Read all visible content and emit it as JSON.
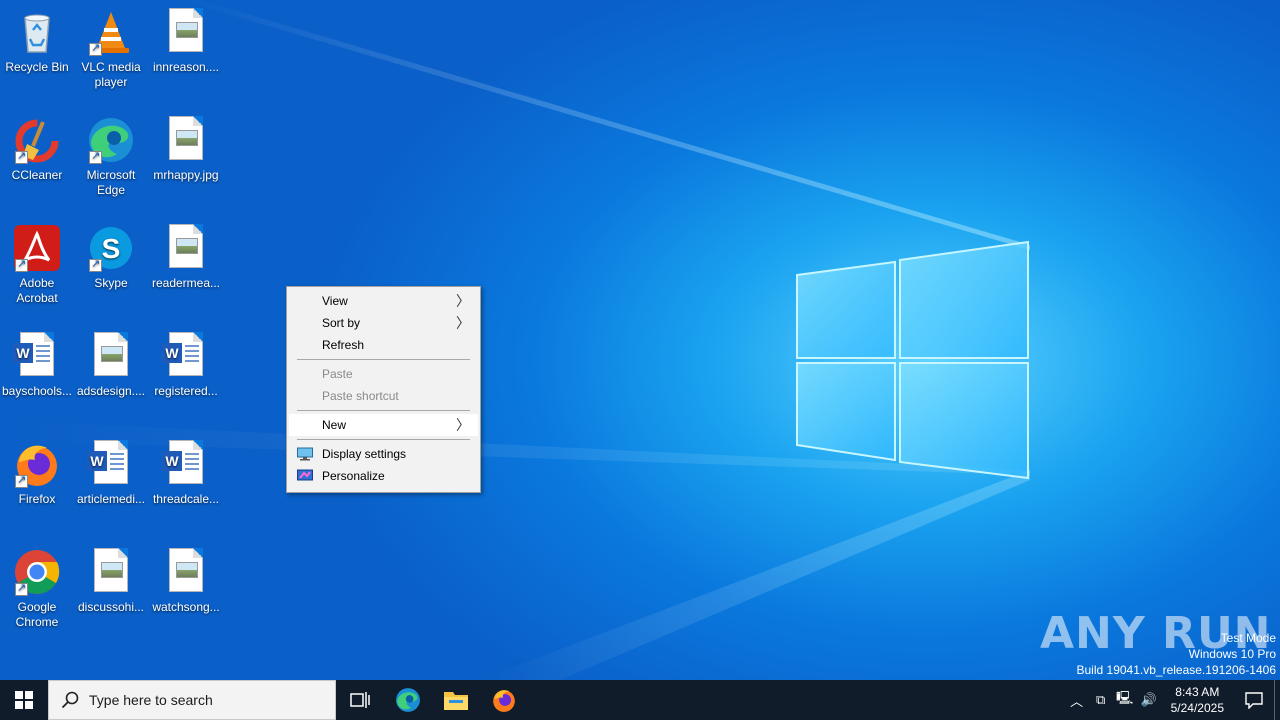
{
  "desktop": {
    "icons": [
      {
        "label": "Recycle Bin",
        "icon": "recycle-bin-icon"
      },
      {
        "label": "VLC media player",
        "icon": "vlc-icon"
      },
      {
        "label": "innreason....",
        "icon": "image-file-icon"
      },
      {
        "label": "CCleaner",
        "icon": "ccleaner-icon"
      },
      {
        "label": "Microsoft Edge",
        "icon": "edge-icon"
      },
      {
        "label": "mrhappy.jpg",
        "icon": "image-file-icon"
      },
      {
        "label": "Adobe Acrobat",
        "icon": "acrobat-icon"
      },
      {
        "label": "Skype",
        "icon": "skype-icon"
      },
      {
        "label": "readermea...",
        "icon": "image-file-icon"
      },
      {
        "label": "bayschools...",
        "icon": "word-doc-icon"
      },
      {
        "label": "adsdesign....",
        "icon": "image-file-icon"
      },
      {
        "label": "registered...",
        "icon": "word-doc-icon"
      },
      {
        "label": "Firefox",
        "icon": "firefox-icon"
      },
      {
        "label": "articlemedi...",
        "icon": "word-doc-icon"
      },
      {
        "label": "threadcale...",
        "icon": "word-doc-icon"
      },
      {
        "label": "Google Chrome",
        "icon": "chrome-icon"
      },
      {
        "label": "discussohi...",
        "icon": "image-file-icon"
      },
      {
        "label": "watchsong...",
        "icon": "image-file-icon"
      }
    ]
  },
  "context_menu": {
    "items": [
      {
        "label": "View",
        "submenu": true
      },
      {
        "label": "Sort by",
        "submenu": true
      },
      {
        "label": "Refresh"
      },
      {
        "label": "Paste",
        "disabled": true
      },
      {
        "label": "Paste shortcut",
        "disabled": true
      },
      {
        "label": "New",
        "submenu": true,
        "highlighted": true
      },
      {
        "label": "Display settings",
        "icon": "display-settings-icon"
      },
      {
        "label": "Personalize",
        "icon": "personalize-icon"
      }
    ]
  },
  "watermark": {
    "brand": "ANY RUN",
    "line1": "Test Mode",
    "line2": "Windows 10 Pro",
    "line3": "Build 19041.vb_release.191206-1406"
  },
  "taskbar": {
    "search_placeholder": "Type here to search",
    "time": "8:43 AM",
    "date": "5/24/2025"
  },
  "colors": {
    "wallpaper": "#0a78dd",
    "taskbar": "#101c2a",
    "menu_bg": "#f2f2f2"
  }
}
